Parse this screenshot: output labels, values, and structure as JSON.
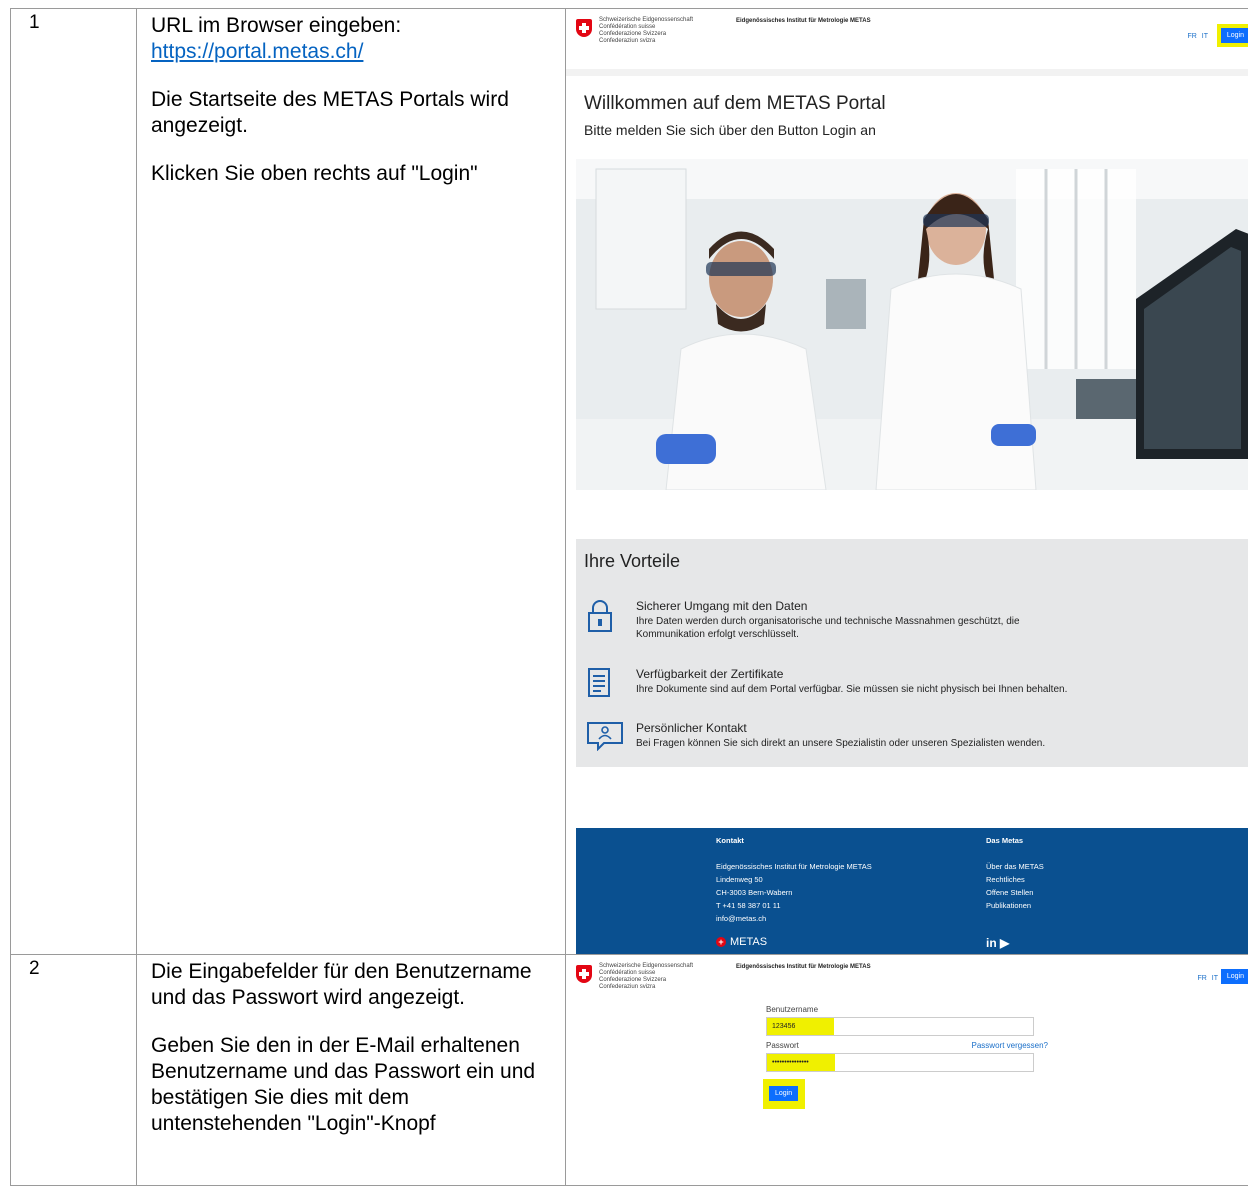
{
  "steps": [
    {
      "num": "1",
      "paragraphs": [
        "URL im Browser eingeben:",
        "Die Startseite des METAS Portals wird angezeigt.",
        "Klicken Sie oben rechts auf \"Login\""
      ],
      "url": "https://portal.metas.ch/"
    },
    {
      "num": "2",
      "paragraphs": [
        "Die Eingabefelder für den Benutzername und das Passwort wird angezeigt.",
        "Geben Sie den in der E-Mail erhaltenen Benutzername und das Passwort ein und bestätigen Sie dies mit dem untenstehenden \"Login\"-Knopf"
      ]
    }
  ],
  "portal": {
    "confederation": [
      "Schweizerische Eidgenossenschaft",
      "Confédération suisse",
      "Confederazione Svizzera",
      "Confederaziun svizra"
    ],
    "institute": "Eidgenössisches Institut für Metrologie METAS",
    "lang_fr": "FR",
    "lang_it": "IT",
    "login": "Login",
    "welcome_title": "Willkommen auf dem METAS Portal",
    "welcome_sub": "Bitte melden Sie sich über den Button Login an",
    "advantages_title": "Ihre Vorteile",
    "advantages": [
      {
        "icon": "lock-icon",
        "title": "Sicherer Umgang mit den Daten",
        "text": "Ihre Daten werden durch organisatorische und technische Massnahmen geschützt, die Kommunikation erfolgt verschlüsselt."
      },
      {
        "icon": "document-icon",
        "title": "Verfügbarkeit der Zertifikate",
        "text": "Ihre Dokumente sind auf dem Portal verfügbar. Sie müssen sie nicht physisch bei Ihnen behalten."
      },
      {
        "icon": "contact-icon",
        "title": "Persönlicher Kontakt",
        "text": "Bei Fragen können Sie sich direkt an unsere Spezialistin oder unseren Spezialisten wenden."
      }
    ],
    "footer": {
      "contact_title": "Kontakt",
      "contact_lines": [
        "Eidgenössisches Institut für Metrologie METAS",
        "Lindenweg 50",
        "CH-3003 Bern-Wabern",
        "T +41 58 387 01 11",
        "info@metas.ch"
      ],
      "metas_title": "Das Metas",
      "metas_links": [
        "Über das METAS",
        "Rechtliches",
        "Offene Stellen",
        "Publikationen"
      ],
      "brand": "METAS",
      "social": "in ▶"
    },
    "form": {
      "username_label": "Benutzername",
      "username_value": "123456",
      "password_label": "Passwort",
      "password_value": "•••••••••••••••",
      "forgot": "Passwort vergessen?",
      "submit": "Login"
    }
  }
}
